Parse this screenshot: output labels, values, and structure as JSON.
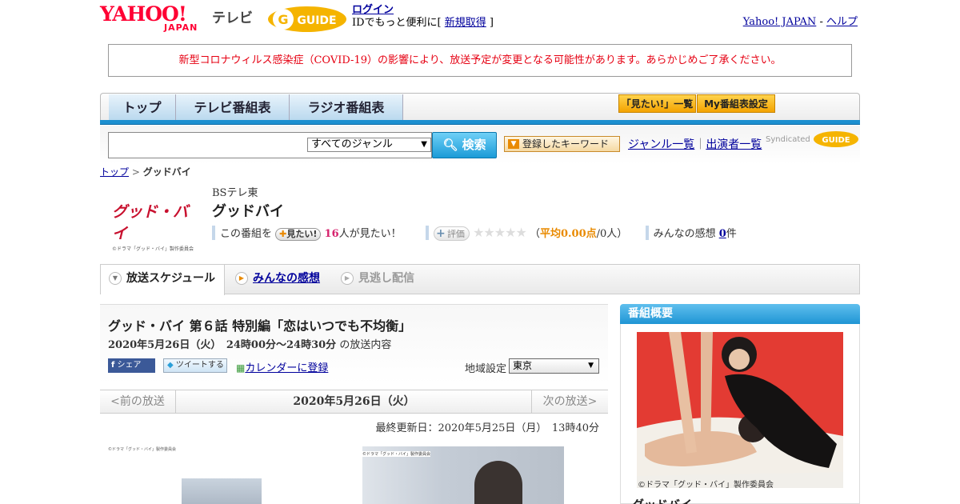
{
  "header": {
    "yahoo_word": "YAHOO!",
    "yahoo_japan": "JAPAN",
    "service": "テレビ",
    "gguide_word": "GUIDE",
    "login": "ログイン",
    "login_sub_prefix": "IDでもっと便利に[ ",
    "signup": "新規取得",
    "login_sub_suffix": " ]",
    "yahoo_japan_link": "Yahoo! JAPAN",
    "sep": " - ",
    "help": "ヘルプ"
  },
  "notice": "新型コロナウィルス感染症（COVID-19）の影響により、放送予定が変更となる可能性があります。あらかじめご了承ください。",
  "nav": {
    "tabs": [
      "トップ",
      "テレビ番組表",
      "ラジオ番組表"
    ],
    "mitai_list": "「見たい!」一覧",
    "my_settings": "My番組表設定"
  },
  "search": {
    "placeholder": "",
    "genre_selected": "すべてのジャンル",
    "button": "検索",
    "keyword_button": "登録したキーワード",
    "genre_list": "ジャンル一覧",
    "pipe": "｜",
    "performer_list": "出演者一覧",
    "syndicated": "Syndicated"
  },
  "breadcrumb": {
    "top": "トップ",
    "sep": " > ",
    "current": "グッドバイ"
  },
  "program": {
    "logo_text": "グッド・バイ",
    "logo_sub": "©ドラマ「グッド・バイ」製作委員会",
    "channel": "BSテレ東",
    "title": "グッドバイ",
    "this_program": "この番組を",
    "mitai_button": "見たい!",
    "mitai_count": "16",
    "mitai_suffix": "人が見たい！",
    "hyouka_button": "評価",
    "stars": "★★★★★",
    "avg_prefix": "（",
    "avg_value": "平均0.00点",
    "avg_suffix": "/0人）",
    "kansou_label": "みんなの感想",
    "kansou_count": "0",
    "kansou_unit": "件",
    "rating": 0
  },
  "subtabs": {
    "schedule": "放送スケジュール",
    "kansou": "みんなの感想",
    "minogashi": "見逃し配信"
  },
  "episode": {
    "title": "グッド・バイ 第６話 特別編「恋はいつでも不均衡」",
    "datetime": "2020年5月26日（火）　24時00分～24時30分",
    "suffix": "の放送内容",
    "fb_share": "シェア",
    "tweet": "ツイートする",
    "calendar": "カレンダーに登録",
    "region_label": "地域設定",
    "region_selected": "東京"
  },
  "day_nav": {
    "prev": "<前の放送",
    "current": "2020年5月26日（火）",
    "next": "次の放送>"
  },
  "updated": "最終更新日：2020年5月25日（月）　13時40分",
  "side": {
    "heading": "番組概要",
    "credit": "©ドラマ「グッド・バイ」製作委員会",
    "title": "グッドバイ"
  },
  "thumbs": {
    "credit1": "©ドラマ「グッド・バイ」製作委員会",
    "credit2": "©ドラマ「グッド・バイ」製作委員会"
  },
  "colors": {
    "yahoo_red": "#ff0033",
    "notice_red": "#e60012",
    "nav_blue": "#1c8fd0",
    "accent_orange": "#e98a00",
    "pink": "#d6246e"
  }
}
